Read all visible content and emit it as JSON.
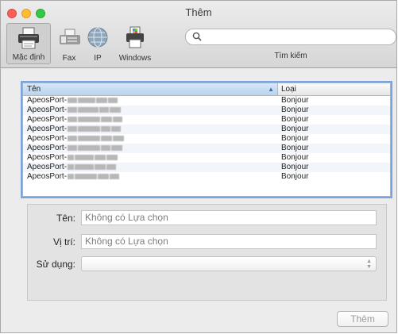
{
  "window": {
    "title": "Thêm"
  },
  "toolbar": {
    "buttons": [
      {
        "label": "Mặc định",
        "icon": "printer-icon",
        "selected": true
      },
      {
        "label": "Fax",
        "icon": "fax-icon"
      },
      {
        "label": "IP",
        "icon": "globe-icon"
      },
      {
        "label": "Windows",
        "icon": "windows-printer-icon"
      }
    ],
    "search": {
      "placeholder": "",
      "value": "",
      "label": "Tìm kiếm",
      "icon": "search-icon"
    }
  },
  "printer_list": {
    "columns": {
      "name": "Tên",
      "type": "Loại",
      "sort_indicator": "▲"
    },
    "rows": [
      {
        "name": "ApeosPort-",
        "type": "Bonjour"
      },
      {
        "name": "ApeosPort-",
        "type": "Bonjour"
      },
      {
        "name": "ApeosPort-",
        "type": "Bonjour"
      },
      {
        "name": "ApeosPort-",
        "type": "Bonjour"
      },
      {
        "name": "ApeosPort-",
        "type": "Bonjour"
      },
      {
        "name": "ApeosPort-",
        "type": "Bonjour"
      },
      {
        "name": "ApeosPort-",
        "type": "Bonjour"
      },
      {
        "name": "ApeosPort-",
        "type": "Bonjour"
      },
      {
        "name": "ApeosPort-",
        "type": "Bonjour"
      }
    ]
  },
  "details": {
    "name_label": "Tên:",
    "name_value": "Không có Lựa chọn",
    "location_label": "Vị trí:",
    "location_value": "Không có Lựa chọn",
    "use_label": "Sử dụng:",
    "use_value": ""
  },
  "add_button": {
    "label": "Thêm"
  },
  "colors": {
    "selection": "#79a4de",
    "close": "#fc5f57",
    "minimize": "#fdbc2e",
    "zoom": "#34c748"
  }
}
